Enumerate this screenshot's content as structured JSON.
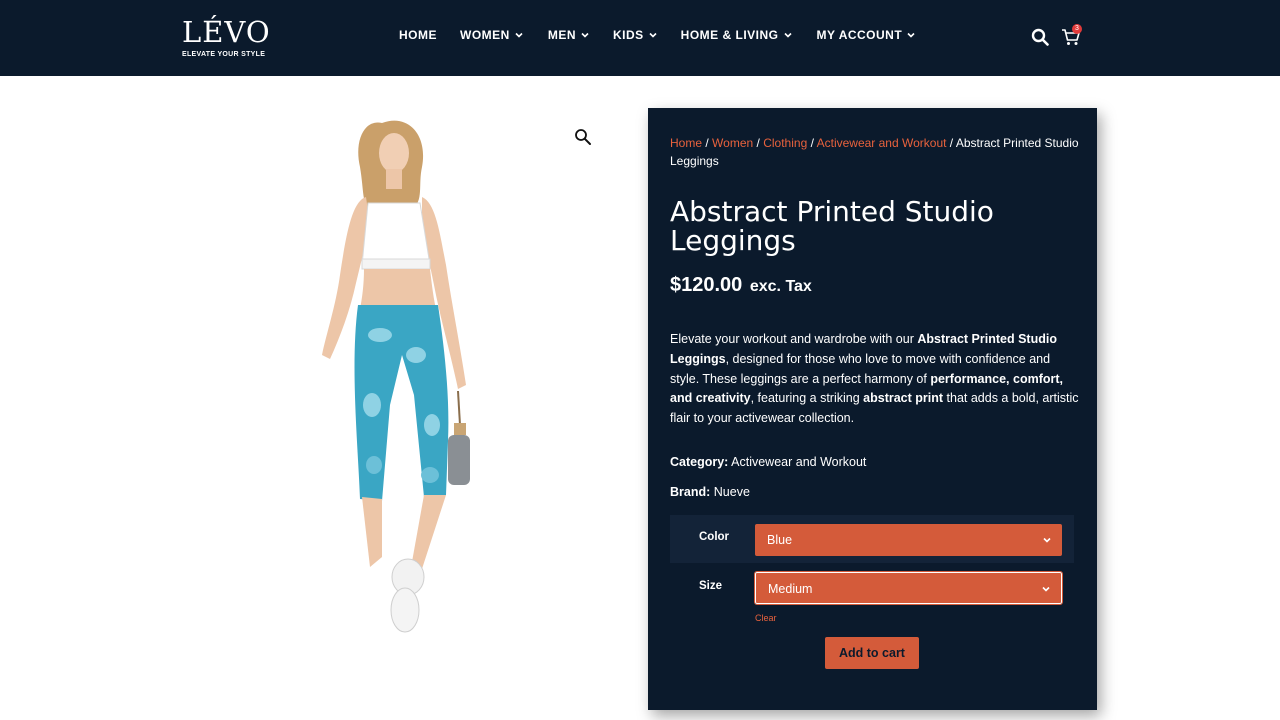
{
  "brand": {
    "name": "LÉVO",
    "tagline": "ELEVATE YOUR STYLE"
  },
  "nav": {
    "items": [
      {
        "label": "HOME",
        "has_dropdown": false
      },
      {
        "label": "WOMEN",
        "has_dropdown": true
      },
      {
        "label": "MEN",
        "has_dropdown": true
      },
      {
        "label": "KIDS",
        "has_dropdown": true
      },
      {
        "label": "HOME & LIVING",
        "has_dropdown": true
      },
      {
        "label": "MY ACCOUNT",
        "has_dropdown": true
      }
    ]
  },
  "header_icons": {
    "search": "search-icon",
    "cart": "cart-icon",
    "cart_count": "3"
  },
  "breadcrumb": {
    "links": [
      "Home",
      "Women",
      "Clothing",
      "Activewear and Workout"
    ],
    "separator": "/",
    "current": "Abstract Printed Studio Leggings"
  },
  "product": {
    "title": "Abstract Printed Studio Leggings",
    "price": "$120.00",
    "tax_note": "exc. Tax",
    "description": [
      {
        "text": "Elevate your workout and wardrobe with our ",
        "bold": false
      },
      {
        "text": "Abstract Printed Studio Leggings",
        "bold": true
      },
      {
        "text": ", designed for those who love to move with confidence and style. These leggings are a perfect harmony of ",
        "bold": false
      },
      {
        "text": "performance, comfort, and creativity",
        "bold": true
      },
      {
        "text": ", featuring a striking ",
        "bold": false
      },
      {
        "text": "abstract print",
        "bold": true
      },
      {
        "text": " that adds a bold, artistic flair to your activewear collection.",
        "bold": false
      }
    ],
    "category_label": "Category:",
    "category_value": "Activewear and Workout",
    "brand_label": "Brand:",
    "brand_value": "Nueve"
  },
  "variations": {
    "color_label": "Color",
    "color_value": "Blue",
    "size_label": "Size",
    "size_value": "Medium",
    "clear_label": "Clear"
  },
  "add_to_cart_label": "Add to cart",
  "colors": {
    "header_bg": "#0b1a2c",
    "accent": "#d45b3a",
    "link": "#e8623d",
    "badge": "#e23a3a"
  }
}
